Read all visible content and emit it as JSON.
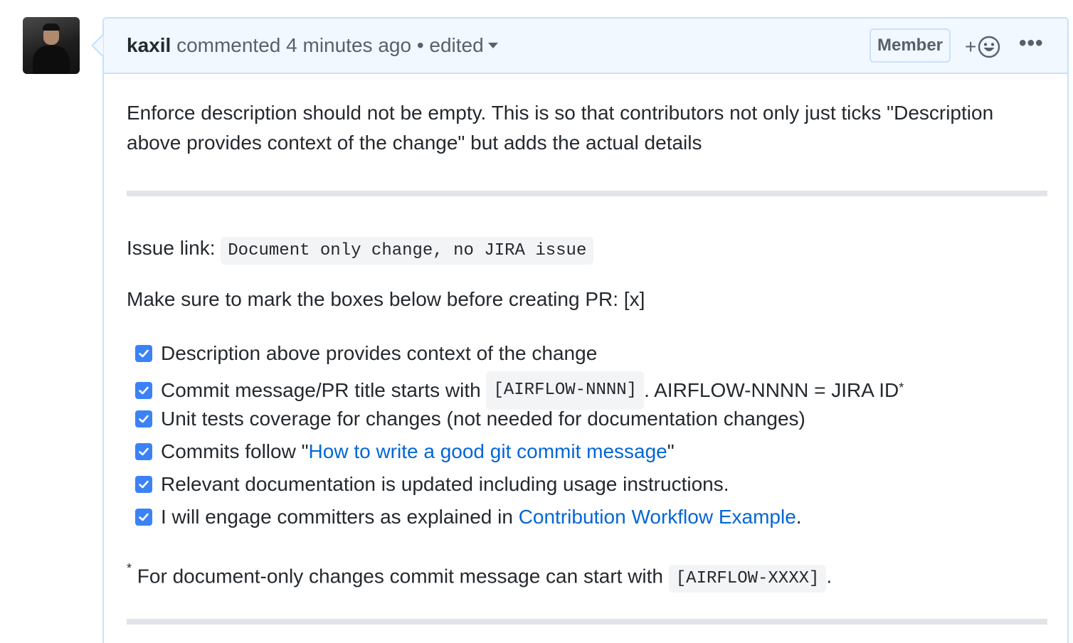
{
  "comment": {
    "author": "kaxil",
    "action": "commented",
    "time": "4 minutes ago",
    "separator": "•",
    "edited_label": "edited",
    "badge": "Member",
    "reaction_plus": "+",
    "more_label": "•••"
  },
  "body": {
    "intro": "Enforce description should not be empty. This is so that contributors not only just ticks \"Description above provides context of the change\" but adds the actual details",
    "issue_label": "Issue link:",
    "issue_code": "Document only change, no JIRA issue",
    "instruction": "Make sure to mark the boxes below before creating PR: [x]",
    "tasks": [
      {
        "checked": true,
        "text": "Description above provides context of the change"
      },
      {
        "checked": true,
        "pre": "Commit message/PR title starts with ",
        "code": "[AIRFLOW-NNNN]",
        "post": ". AIRFLOW-NNNN = JIRA ID",
        "sup": "*"
      },
      {
        "checked": true,
        "text": "Unit tests coverage for changes (not needed for documentation changes)"
      },
      {
        "checked": true,
        "pre": "Commits follow \"",
        "link": "How to write a good git commit message",
        "post": "\""
      },
      {
        "checked": true,
        "text": "Relevant documentation is updated including usage instructions."
      },
      {
        "checked": true,
        "pre": "I will engage committers as explained in ",
        "link": "Contribution Workflow Example",
        "post": "."
      }
    ],
    "footnote_mark": "*",
    "footnote_pre": " For document-only changes commit message can start with ",
    "footnote_code": "[AIRFLOW-XXXX]",
    "footnote_post": "."
  },
  "colors": {
    "header_bg": "#f1f8ff",
    "border": "#c8e1ff",
    "link": "#0366d6",
    "checkbox": "#3b82f6"
  }
}
